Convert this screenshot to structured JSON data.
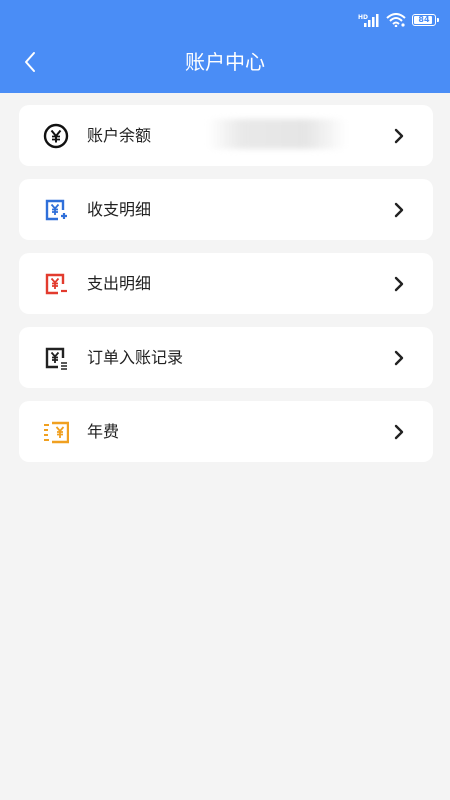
{
  "status_bar": {
    "network_label": "HD",
    "battery_level": "84"
  },
  "header": {
    "title": "账户中心",
    "back_icon": "chevron-left-icon"
  },
  "menu": [
    {
      "label": "账户余额",
      "icon": "yuan-circle-icon",
      "icon_color": "#111111",
      "value": ""
    },
    {
      "label": "收支明细",
      "icon": "yuan-receipt-plus-icon",
      "icon_color": "#2f6fd9"
    },
    {
      "label": "支出明细",
      "icon": "yuan-receipt-minus-icon",
      "icon_color": "#e23b2e"
    },
    {
      "label": "订单入账记录",
      "icon": "yuan-receipt-list-icon",
      "icon_color": "#222222"
    },
    {
      "label": "年费",
      "icon": "yuan-fast-icon",
      "icon_color": "#f0a020"
    }
  ],
  "colors": {
    "header_bg": "#4a8df6",
    "page_bg": "#f4f4f4",
    "card_bg": "#ffffff"
  }
}
